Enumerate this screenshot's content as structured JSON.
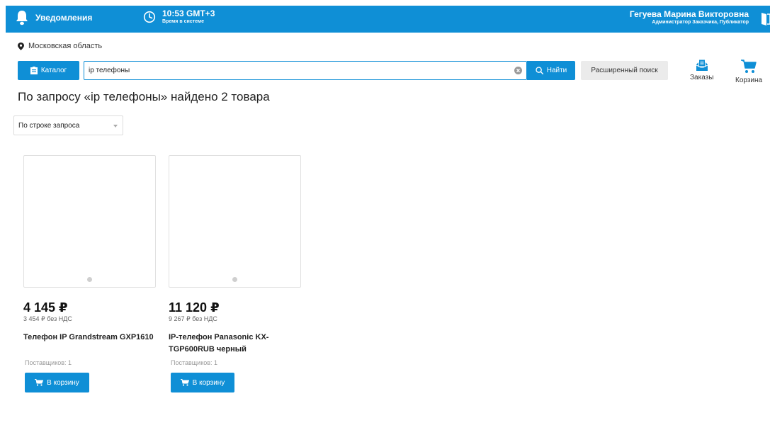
{
  "header": {
    "notifications_label": "Уведомления",
    "time_value": "10:53 GMT+3",
    "time_caption": "Время в системе",
    "user_name": "Гегуева Марина Викторовна",
    "user_role": "Администратор Заказчика, Публикатор"
  },
  "region": {
    "name": "Московская область"
  },
  "search": {
    "catalog_label": "Каталог",
    "query": "ip телефоны",
    "find_label": "Найти",
    "advanced_label": "Расширенный поиск"
  },
  "actions": {
    "orders_label": "Заказы",
    "cart_label": "Корзина"
  },
  "results": {
    "title": "По запросу «ip телефоны» найдено 2 товара",
    "sort_label": "По строке запроса"
  },
  "products": [
    {
      "price": "4 145 ₽",
      "price_net": "3 454 ₽ без НДС",
      "title": "Телефон IP Grandstream GXP1610",
      "suppliers": "Поставщиков: 1",
      "cart_label": "В корзину"
    },
    {
      "price": "11 120 ₽",
      "price_net": "9 267 ₽ без НДС",
      "title": "IP-телефон Panasonic KX-TGP600RUB черный",
      "suppliers": "Поставщиков: 1",
      "cart_label": "В корзину"
    }
  ],
  "colors": {
    "primary": "#0f8fd6",
    "button_gray": "#ebebeb",
    "muted_text": "#999999"
  }
}
